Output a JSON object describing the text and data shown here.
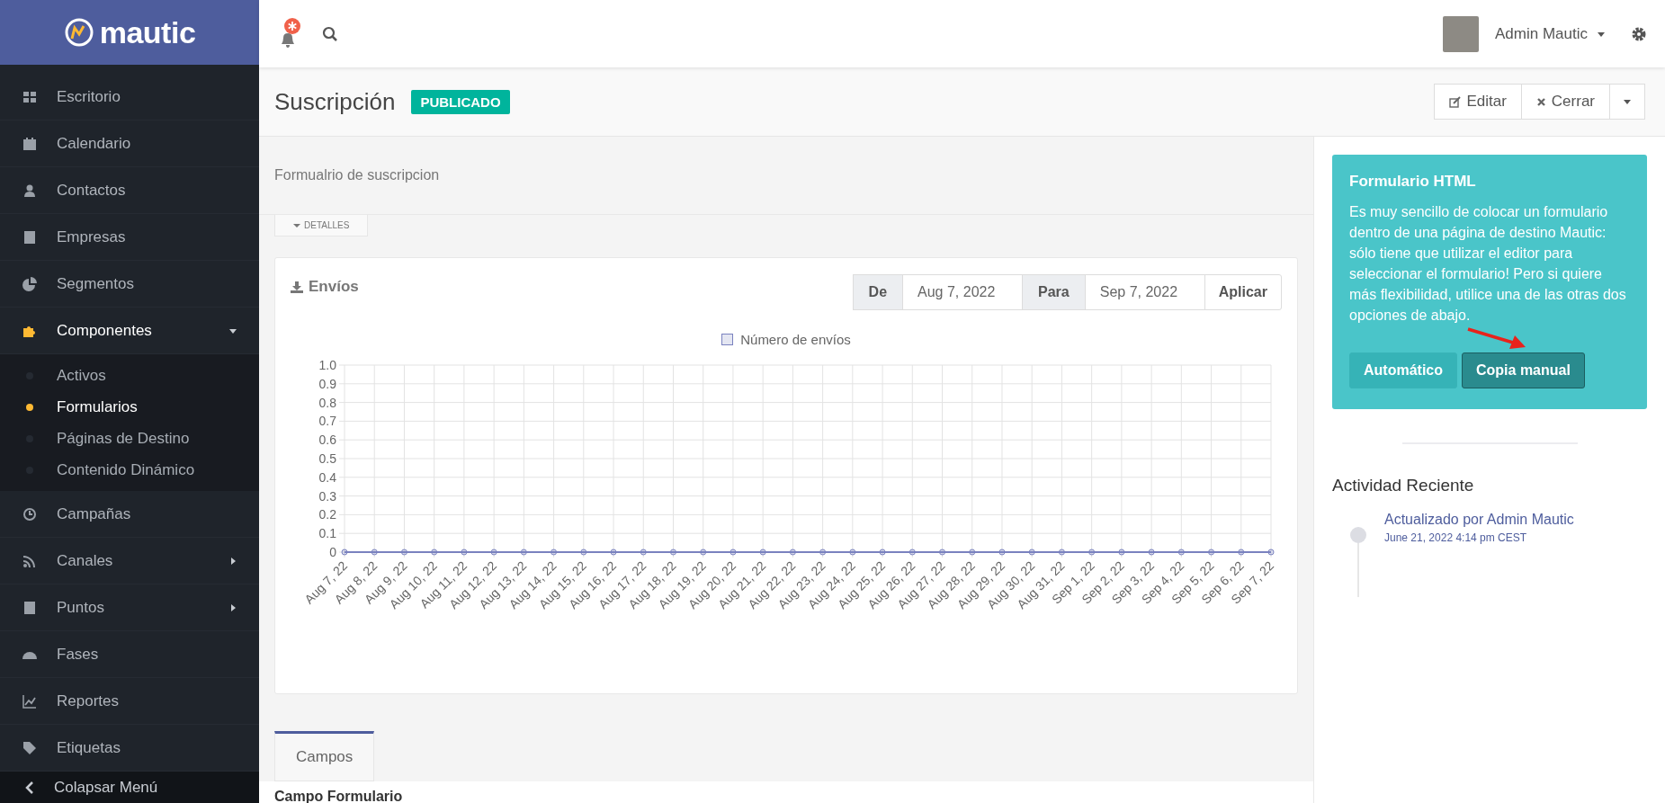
{
  "brand": {
    "name": "mautic"
  },
  "sidebar": {
    "items": [
      {
        "label": "Escritorio",
        "selected": false
      },
      {
        "label": "Calendario",
        "selected": false
      },
      {
        "label": "Contactos",
        "selected": false
      },
      {
        "label": "Empresas",
        "selected": false
      },
      {
        "label": "Segmentos",
        "selected": false
      },
      {
        "label": "Componentes",
        "selected": true,
        "expanded": true,
        "children": [
          {
            "label": "Activos",
            "selected": false
          },
          {
            "label": "Formularios",
            "selected": true
          },
          {
            "label": "Páginas de Destino",
            "selected": false
          },
          {
            "label": "Contenido Dinámico",
            "selected": false
          }
        ]
      },
      {
        "label": "Campañas",
        "selected": false
      },
      {
        "label": "Canales",
        "selected": false,
        "expanded": false
      },
      {
        "label": "Puntos",
        "selected": false,
        "expanded": false
      },
      {
        "label": "Fases",
        "selected": false
      },
      {
        "label": "Reportes",
        "selected": false
      },
      {
        "label": "Etiquetas",
        "selected": false
      }
    ],
    "collapse": "Colapsar Menú"
  },
  "topbar": {
    "user": "Admin Mautic"
  },
  "page": {
    "title": "Suscripción",
    "status": "PUBLICADO",
    "actions": [
      {
        "label": "Editar",
        "kind": "edit"
      },
      {
        "label": "Cerrar",
        "kind": "close"
      }
    ],
    "description": "Formualrio de suscripcion",
    "details_toggle": "DETALLES"
  },
  "chart_card": {
    "title": "Envíos",
    "from_label": "De",
    "from": "Aug 7, 2022",
    "to_label": "Para",
    "to": "Sep 7, 2022",
    "apply": "Aplicar",
    "chart_data": {
      "type": "line",
      "categories": [
        "Aug 7, 22",
        "Aug 8, 22",
        "Aug 9, 22",
        "Aug 10, 22",
        "Aug 11, 22",
        "Aug 12, 22",
        "Aug 13, 22",
        "Aug 14, 22",
        "Aug 15, 22",
        "Aug 16, 22",
        "Aug 17, 22",
        "Aug 18, 22",
        "Aug 19, 22",
        "Aug 20, 22",
        "Aug 21, 22",
        "Aug 22, 22",
        "Aug 23, 22",
        "Aug 24, 22",
        "Aug 25, 22",
        "Aug 26, 22",
        "Aug 27, 22",
        "Aug 28, 22",
        "Aug 29, 22",
        "Aug 30, 22",
        "Aug 31, 22",
        "Sep 1, 22",
        "Sep 2, 22",
        "Sep 3, 22",
        "Sep 4, 22",
        "Sep 5, 22",
        "Sep 6, 22",
        "Sep 7, 22"
      ],
      "grid": true,
      "series": [
        {
          "name": "Número de envíos",
          "color": "#7a82bf",
          "marker": "circle",
          "values": [
            0,
            0,
            0,
            0,
            0,
            0,
            0,
            0,
            0,
            0,
            0,
            0,
            0,
            0,
            0,
            0,
            0,
            0,
            0,
            0,
            0,
            0,
            0,
            0,
            0,
            0,
            0,
            0,
            0,
            0,
            0,
            0
          ]
        }
      ],
      "ylim": [
        0,
        1
      ],
      "yticks": [
        0,
        0.1,
        0.2,
        0.3,
        0.4,
        0.5,
        0.6,
        0.7,
        0.8,
        0.9,
        {
          "value": 1,
          "label": "1.0"
        }
      ]
    }
  },
  "tabs": [
    {
      "label": "Campos",
      "selected": true
    }
  ],
  "section_title": "Campo Formulario",
  "html_form_card": {
    "title": "Formulario HTML",
    "text": "Es muy sencillo de colocar un formulario dentro de una página de destino Mautic: sólo tiene que utilizar el editor para seleccionar el formulario! Pero si quiere más flexibilidad, utilice una de las otras dos opciones de abajo.",
    "buttons": [
      {
        "label": "Automático",
        "selected": false
      },
      {
        "label": "Copia manual",
        "selected": true
      }
    ]
  },
  "recent_activity": {
    "title": "Actividad Reciente",
    "entries": [
      {
        "text": "Actualizado por",
        "link": "Admin Mautic",
        "time": "June 21, 2022 4:14 pm CEST"
      }
    ]
  }
}
